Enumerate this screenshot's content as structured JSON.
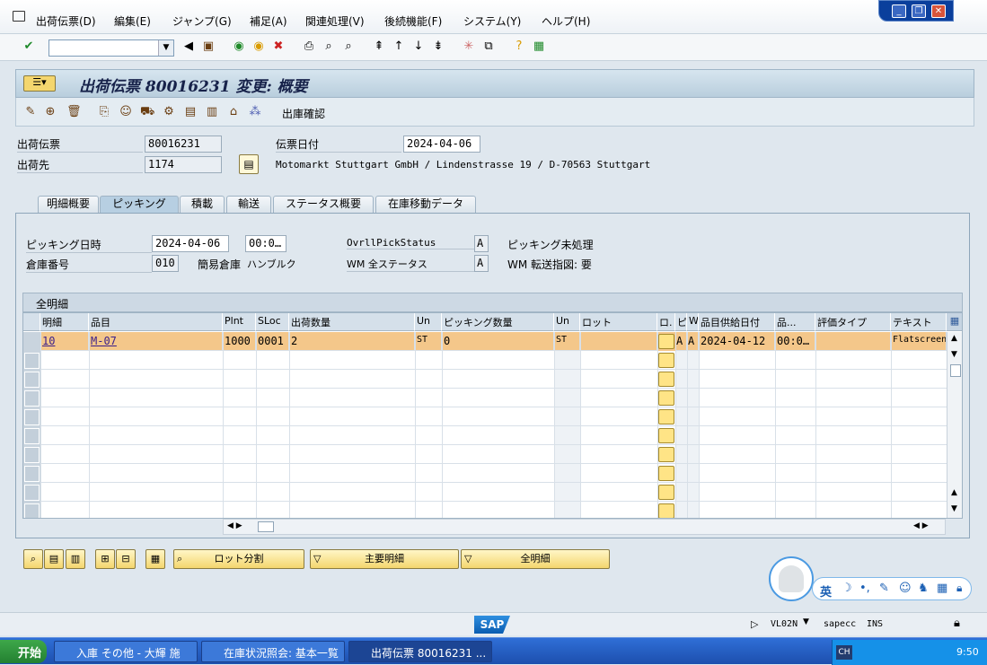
{
  "menu": {
    "items": [
      "出荷伝票(D)",
      "編集(E)",
      "ジャンプ(G)",
      "補足(A)",
      "関連処理(V)",
      "後続機能(F)",
      "システム(Y)",
      "ヘルプ(H)"
    ]
  },
  "window": {
    "min": "_",
    "restore": "❐",
    "close": "✕"
  },
  "title": "出荷伝票 80016231 変更: 概要",
  "appbar": {
    "goods_issue_label": "出庫確認"
  },
  "header": {
    "delivery_label": "出荷伝票",
    "delivery_value": "80016231",
    "ship_to_label": "出荷先",
    "ship_to_value": "1174",
    "doc_date_label": "伝票日付",
    "doc_date_value": "2024-04-06",
    "address": "Motomarkt Stuttgart GmbH / Lindenstrasse 19 / D-70563 Stuttgart"
  },
  "tabs": [
    "明細概要",
    "ピッキング",
    "積載",
    "輸送",
    "ステータス概要",
    "在庫移動データ"
  ],
  "picking": {
    "date_label": "ピッキング日時",
    "date_value": "2024-04-06",
    "time_value": "00:0…",
    "warehouse_label": "倉庫番号",
    "warehouse_value": "010",
    "lean_wm_label": "簡易倉庫",
    "lean_wm_value": "ハンブルク",
    "ovrl_label": "OvrllPickStatus",
    "ovrl_value": "A",
    "ovrl_text": "ピッキング未処理",
    "wm_label": "WM 全ステータス",
    "wm_value": "A",
    "wm_text": "WM 転送指図: 要"
  },
  "table": {
    "title": "全明細",
    "headers": [
      "明細",
      "品目",
      "Plnt",
      "SLoc",
      "出荷数量",
      "Un",
      "ピッキング数量",
      "Un",
      "ロット",
      "ロ.",
      "ピ",
      "W.",
      "品目供給日付",
      "品...",
      "評価タイプ",
      "テキスト"
    ],
    "row": {
      "item": "10",
      "material": "M-07",
      "plant": "1000",
      "sloc": "0001",
      "qty": "2",
      "un": "ST",
      "pick_qty": "0",
      "pick_un": "ST",
      "batch": "",
      "p": "A",
      "w": "A",
      "avail_date": "2024-04-12",
      "time": "00:0…",
      "val_type": "",
      "text": "Flatscreen"
    }
  },
  "buttons": {
    "batch_split": "ロット分割",
    "main_items": "主要明細",
    "all_items": "全明細"
  },
  "status": {
    "tcode": "VL02N",
    "server": "sapecc",
    "mode": "INS"
  },
  "taskbar": {
    "start": "开始",
    "tasks": [
      "入庫 その他 - 大輝 施",
      "在庫状況照会: 基本一覧",
      "出荷伝票 80016231 ..."
    ],
    "time": "9:50",
    "lang": "CH"
  },
  "ime": {
    "lang": "英"
  },
  "colors": {
    "selected_row": "#f4c78a",
    "button": "#f4d66e",
    "title_bg": "#b9cedd"
  }
}
